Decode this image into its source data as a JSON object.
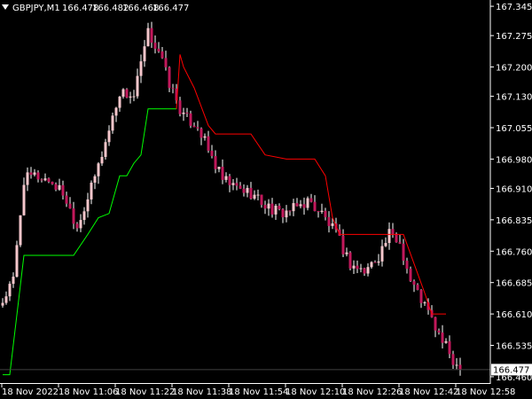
{
  "header": {
    "symbol": "GBPJPY,M1",
    "open": "166.478",
    "high": "166.482",
    "low": "166.468",
    "close": "166.477",
    "menu_icon": "triangle-down-icon"
  },
  "current_price_label": "166.477",
  "price_tick_labels": [
    "167.345",
    "167.275",
    "167.200",
    "167.130",
    "167.055",
    "166.980",
    "166.910",
    "166.835",
    "166.760",
    "166.685",
    "166.610",
    "166.535",
    "166.460"
  ],
  "time_tick_labels": [
    "18 Nov 2022",
    "18 Nov 11:06",
    "18 Nov 11:22",
    "18 Nov 11:38",
    "18 Nov 11:54",
    "18 Nov 12:10",
    "18 Nov 12:26",
    "18 Nov 12:42",
    "18 Nov 12:58"
  ],
  "colors": {
    "background": "#000000",
    "bull_candle": "#f5c6cb",
    "bear_candle": "#c2185b",
    "wick": "#ffffff",
    "support_line": "#00ff00",
    "resistance_line": "#ff0000",
    "price_line": "#404040",
    "axis": "#ffffff",
    "price_box_bg": "#ffffff"
  },
  "chart_data": {
    "type": "candlestick",
    "symbol": "GBPJPY",
    "timeframe": "M1",
    "ylim": [
      166.445,
      167.36
    ],
    "bars_approx": 145,
    "close_path": [
      {
        "bar": 0,
        "close": 166.64
      },
      {
        "bar": 3,
        "close": 166.69
      },
      {
        "bar": 6,
        "close": 166.93
      },
      {
        "bar": 9,
        "close": 166.94
      },
      {
        "bar": 13,
        "close": 166.93
      },
      {
        "bar": 17,
        "close": 166.9
      },
      {
        "bar": 21,
        "close": 166.82
      },
      {
        "bar": 25,
        "close": 166.91
      },
      {
        "bar": 29,
        "close": 167.02
      },
      {
        "bar": 33,
        "close": 167.14
      },
      {
        "bar": 37,
        "close": 167.13
      },
      {
        "bar": 41,
        "close": 167.28
      },
      {
        "bar": 44,
        "close": 167.24
      },
      {
        "bar": 47,
        "close": 167.16
      },
      {
        "bar": 51,
        "close": 167.08
      },
      {
        "bar": 55,
        "close": 167.06
      },
      {
        "bar": 58,
        "close": 167.0
      },
      {
        "bar": 62,
        "close": 166.93
      },
      {
        "bar": 66,
        "close": 166.91
      },
      {
        "bar": 70,
        "close": 166.9
      },
      {
        "bar": 74,
        "close": 166.87
      },
      {
        "bar": 78,
        "close": 166.85
      },
      {
        "bar": 82,
        "close": 166.86
      },
      {
        "bar": 86,
        "close": 166.88
      },
      {
        "bar": 90,
        "close": 166.85
      },
      {
        "bar": 94,
        "close": 166.8
      },
      {
        "bar": 98,
        "close": 166.73
      },
      {
        "bar": 102,
        "close": 166.71
      },
      {
        "bar": 106,
        "close": 166.75
      },
      {
        "bar": 109,
        "close": 166.8
      },
      {
        "bar": 112,
        "close": 166.78
      },
      {
        "bar": 115,
        "close": 166.69
      },
      {
        "bar": 119,
        "close": 166.63
      },
      {
        "bar": 123,
        "close": 166.56
      },
      {
        "bar": 127,
        "close": 166.5
      },
      {
        "bar": 129,
        "close": 166.477
      }
    ],
    "support_line": [
      {
        "bar": 0,
        "value": 166.465
      },
      {
        "bar": 2,
        "value": 166.465
      },
      {
        "bar": 6,
        "value": 166.75
      },
      {
        "bar": 20,
        "value": 166.75
      },
      {
        "bar": 24,
        "value": 166.8
      },
      {
        "bar": 27,
        "value": 166.84
      },
      {
        "bar": 30,
        "value": 166.85
      },
      {
        "bar": 31,
        "value": 166.88
      },
      {
        "bar": 33,
        "value": 166.94
      },
      {
        "bar": 35,
        "value": 166.94
      },
      {
        "bar": 37,
        "value": 166.97
      },
      {
        "bar": 39,
        "value": 166.99
      },
      {
        "bar": 41,
        "value": 167.1
      },
      {
        "bar": 45,
        "value": 167.1
      },
      {
        "bar": 49,
        "value": 167.1
      }
    ],
    "resistance_line": [
      {
        "bar": 49,
        "value": 167.1
      },
      {
        "bar": 50,
        "value": 167.23
      },
      {
        "bar": 51,
        "value": 167.2
      },
      {
        "bar": 54,
        "value": 167.15
      },
      {
        "bar": 58,
        "value": 167.06
      },
      {
        "bar": 60,
        "value": 167.04
      },
      {
        "bar": 70,
        "value": 167.04
      },
      {
        "bar": 74,
        "value": 166.99
      },
      {
        "bar": 80,
        "value": 166.98
      },
      {
        "bar": 88,
        "value": 166.98
      },
      {
        "bar": 91,
        "value": 166.94
      },
      {
        "bar": 93,
        "value": 166.84
      },
      {
        "bar": 95,
        "value": 166.8
      },
      {
        "bar": 113,
        "value": 166.8
      },
      {
        "bar": 116,
        "value": 166.73
      },
      {
        "bar": 119,
        "value": 166.66
      },
      {
        "bar": 121,
        "value": 166.61
      },
      {
        "bar": 125,
        "value": 166.61
      }
    ]
  }
}
